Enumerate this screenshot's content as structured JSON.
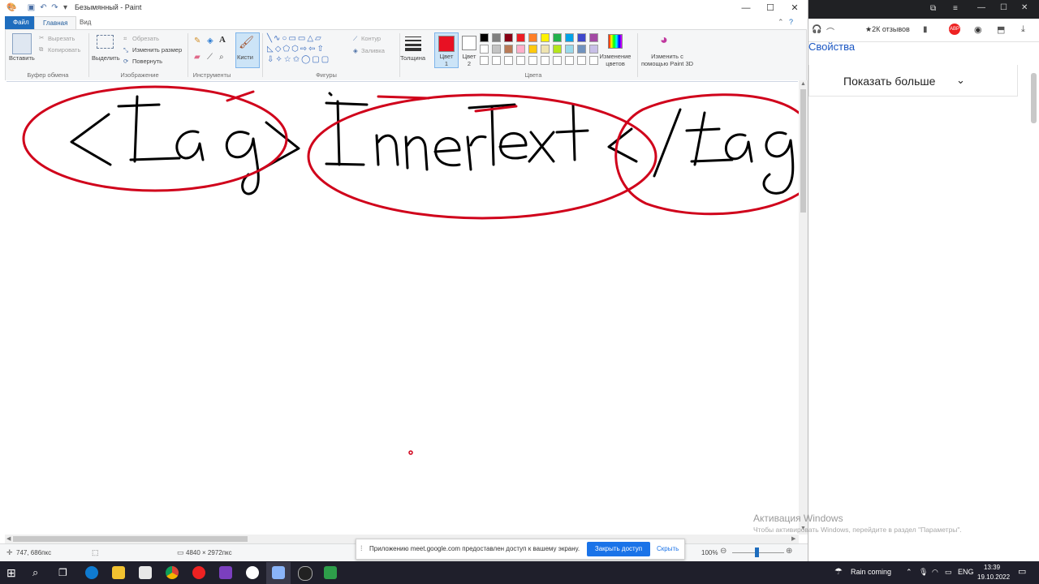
{
  "window": {
    "title": "Безымянный - Paint",
    "controls": {
      "minimize": "—",
      "maximize": "☐",
      "close": "✕"
    }
  },
  "tabs": {
    "file": "Файл",
    "home": "Главная",
    "view": "Вид"
  },
  "ribbon": {
    "clipboard": {
      "paste": "Вставить",
      "cut": "Вырезать",
      "copy": "Копировать",
      "group": "Буфер обмена"
    },
    "image": {
      "select": "Выделить",
      "crop": "Обрезать",
      "resize": "Изменить размер",
      "rotate": "Повернуть",
      "group": "Изображение"
    },
    "tools": {
      "group": "Инструменты"
    },
    "brushes": {
      "label": "Кисти"
    },
    "shapes": {
      "outline": "Контур",
      "fill": "Заливка",
      "group": "Фигуры"
    },
    "size": {
      "label": "Толщина"
    },
    "colors": {
      "color1": "Цвет 1",
      "color2": "Цвет 2",
      "edit": "Изменение цветов",
      "group": "Цвета",
      "color1_value": "#e81123",
      "palette_row1": [
        "#000000",
        "#7f7f7f",
        "#880015",
        "#ed1c24",
        "#ff7f27",
        "#fff200",
        "#22b14c",
        "#00a2e8",
        "#3f48cc",
        "#a349a4"
      ],
      "palette_row2": [
        "#ffffff",
        "#c3c3c3",
        "#b97a57",
        "#ffaec9",
        "#ffc90e",
        "#efe4b0",
        "#b5e61d",
        "#99d9ea",
        "#7092be",
        "#c8bfe7"
      ]
    },
    "paint3d": "Изменить с помощью Paint 3D"
  },
  "canvas": {
    "ink_color": "#000000",
    "circle_color": "#d0021b"
  },
  "status": {
    "cursor": "747, 686пкс",
    "size": "4840 × 2972пкс",
    "zoom": "100%"
  },
  "share_bar": {
    "message": "Приложению meet.google.com предоставлен доступ к вашему экрану.",
    "stop": "Закрыть доступ",
    "hide": "Скрыть"
  },
  "browser": {
    "bookmark": "★2К отзывов",
    "properties": "Свойства",
    "show_more": "Показать больше"
  },
  "activation": {
    "title": "Активация Windows",
    "subtitle": "Чтобы активировать Windows, перейдите в раздел \"Параметры\"."
  },
  "taskbar": {
    "weather": "Rain coming",
    "lang": "ENG",
    "time": "13:39",
    "date": "19.10.2022"
  }
}
